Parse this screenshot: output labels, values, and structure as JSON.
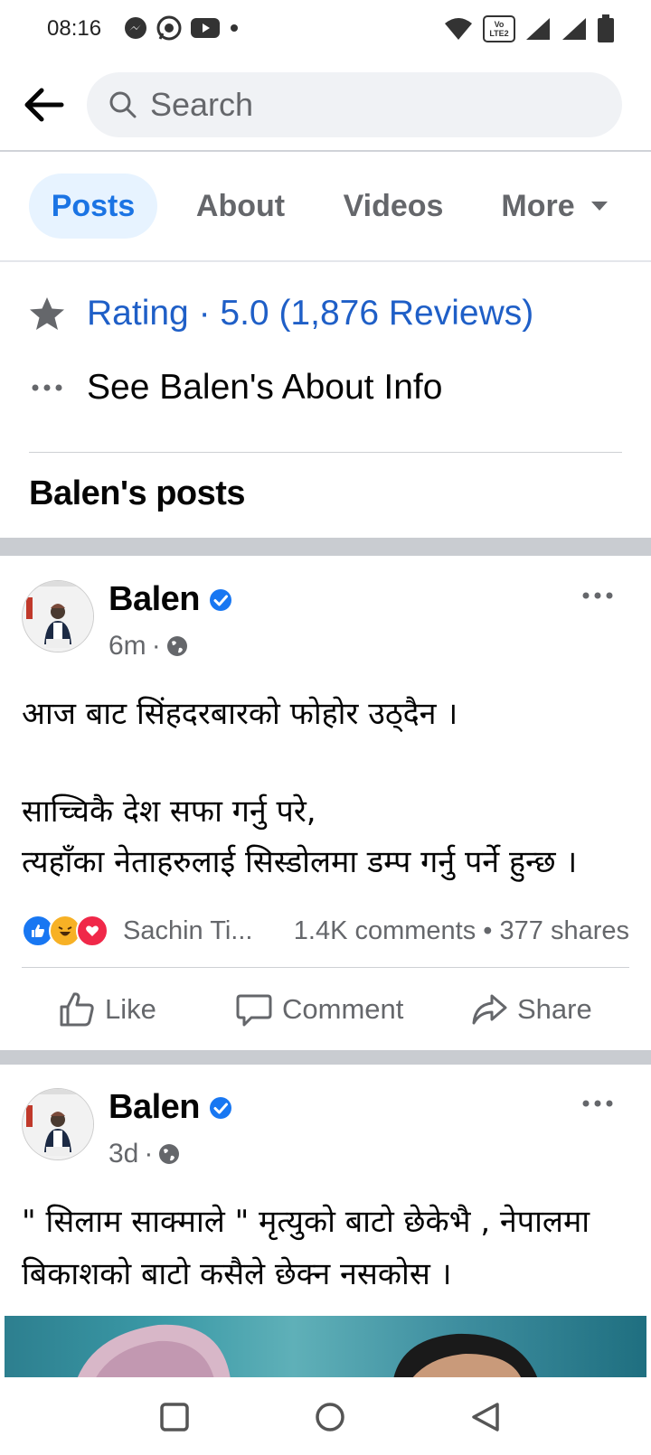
{
  "status_bar": {
    "time": "08:16",
    "network_label": "Vo LTE2"
  },
  "search": {
    "placeholder": "Search"
  },
  "tabs": [
    {
      "label": "Posts",
      "active": true
    },
    {
      "label": "About"
    },
    {
      "label": "Videos"
    },
    {
      "label": "More"
    }
  ],
  "rating": {
    "text": "Rating · 5.0 (1,876 Reviews)"
  },
  "about_link": {
    "text": "See Balen's About Info"
  },
  "section": {
    "title": "Balen's posts"
  },
  "posts": [
    {
      "author": "Balen",
      "time": "6m",
      "separator": "·",
      "text_line1": "आज बाट सिंहदरबारको फोहोर उठ्दैन ।",
      "text_line2": "साच्चिकै देश सफा गर्नु परे,",
      "text_line3": "त्यहाँका नेताहरुलाई सिस्डोलमा डम्प गर्नु पर्ने हुन्छ ।",
      "reactor": "Sachin Ti...",
      "counts": "1.4K comments • 377 shares",
      "actions": {
        "like": "Like",
        "comment": "Comment",
        "share": "Share"
      }
    },
    {
      "author": "Balen",
      "time": "3d",
      "separator": "·",
      "text_line1": "\" सिलाम साक्माले \" मृत्युको बाटो छेकेभै , नेपालमा",
      "text_line2": "बिकाशको बाटो कसैले छेक्न नसकोस ।"
    }
  ],
  "colors": {
    "accent": "#1b74e4",
    "link": "#1f5fc7",
    "muted": "#65676b",
    "tab_active_bg": "#e7f3ff",
    "separator": "#c9ccd1"
  }
}
